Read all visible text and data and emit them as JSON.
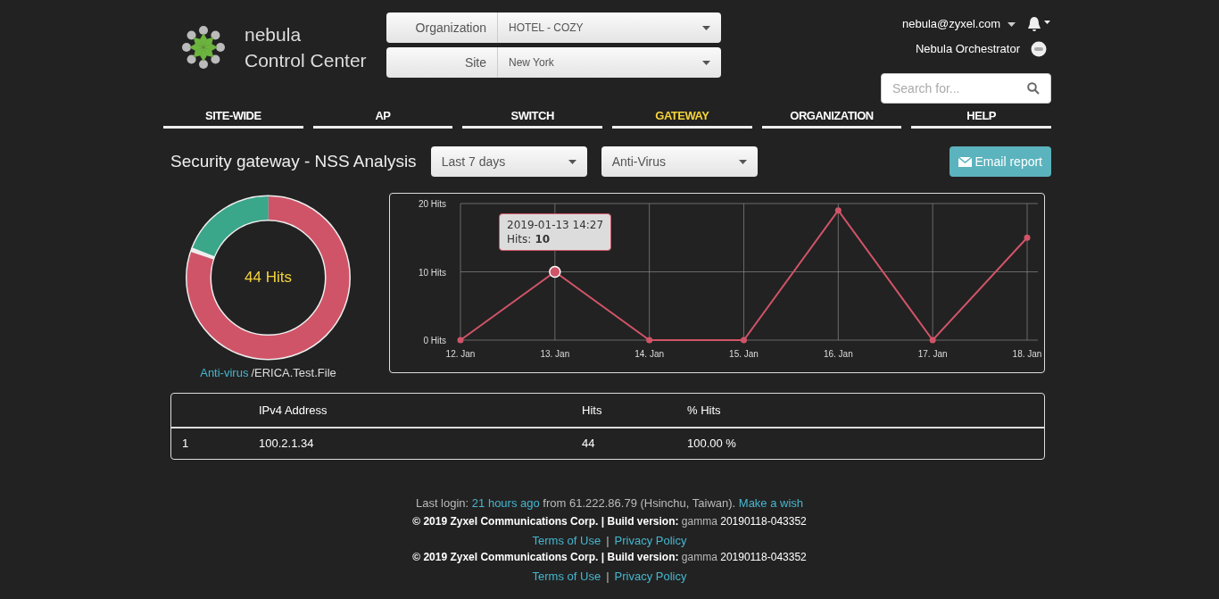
{
  "logo": {
    "line1": "nebula",
    "line2": "Control Center"
  },
  "selectors": [
    {
      "label": "Organization",
      "value": "HOTEL - COZY"
    },
    {
      "label": "Site",
      "value": "New York"
    }
  ],
  "account": {
    "email": "nebula@zyxel.com",
    "orchestrator": "Nebula Orchestrator"
  },
  "search": {
    "placeholder": "Search for..."
  },
  "tabs": [
    {
      "label": "SITE-WIDE",
      "selected": false
    },
    {
      "label": "AP",
      "selected": false
    },
    {
      "label": "SWITCH",
      "selected": false
    },
    {
      "label": "GATEWAY",
      "selected": true
    },
    {
      "label": "ORGANIZATION",
      "selected": false
    },
    {
      "label": "HELP",
      "selected": false
    }
  ],
  "page_title": "Security gateway - NSS Analysis",
  "filters": [
    {
      "value": "Last 7 days"
    },
    {
      "value": "Anti-Virus"
    }
  ],
  "email_button": "Email report",
  "donut": {
    "center_label": "44 Hits",
    "legend_link": "Anti-virus",
    "legend_text": "/ERICA.Test.File"
  },
  "chart": {
    "tooltip": {
      "time": "2019-01-13 14:27",
      "separator": ":",
      "value": "10"
    },
    "chart_data": {
      "type": "line",
      "grid": true,
      "categories": [
        "12. Jan",
        "13. Jan",
        "14. Jan",
        "15. Jan",
        "16. Jan",
        "17. Jan",
        "18. Jan"
      ],
      "ylim": [
        0,
        20
      ],
      "yticks": [
        {
          "value": 0,
          "label": "0 Hits"
        },
        {
          "value": 10,
          "label": "10 Hits"
        },
        {
          "value": 20,
          "label": "20 Hits"
        }
      ],
      "series": [
        {
          "name": "Hits",
          "color": "#d05468",
          "marker": "circle",
          "values": [
            0,
            10,
            0,
            0,
            19,
            0,
            15
          ]
        }
      ]
    }
  },
  "table": {
    "columns": [
      "",
      "IPv4 Address",
      "Hits",
      "% Hits"
    ],
    "rows": [
      [
        "1",
        "100.2.1.34",
        "44",
        "100.00 %"
      ]
    ]
  },
  "footer": {
    "login_prefix": "Last login:",
    "login_link": "21 hours ago",
    "login_middle": "from 61.222.86.79 (Hsinchu, Taiwan).",
    "wish_link": "Make a wish",
    "blocks": [
      {
        "copyright": "© 2019 Zyxel Communications Corp.",
        "separator": "|",
        "build_label": "Build version:",
        "build_channel": "gamma",
        "build_number": "20190118-043352",
        "terms": "Terms of Use",
        "link_separator": "|",
        "privacy": "Privacy Policy"
      },
      {
        "copyright": "© 2019 Zyxel Communications Corp.",
        "separator": "|",
        "build_label": "Build version:",
        "build_channel": "gamma",
        "build_number": "20190118-043352",
        "terms": "Terms of Use",
        "link_separator": "|",
        "privacy": "Privacy Policy"
      }
    ]
  }
}
